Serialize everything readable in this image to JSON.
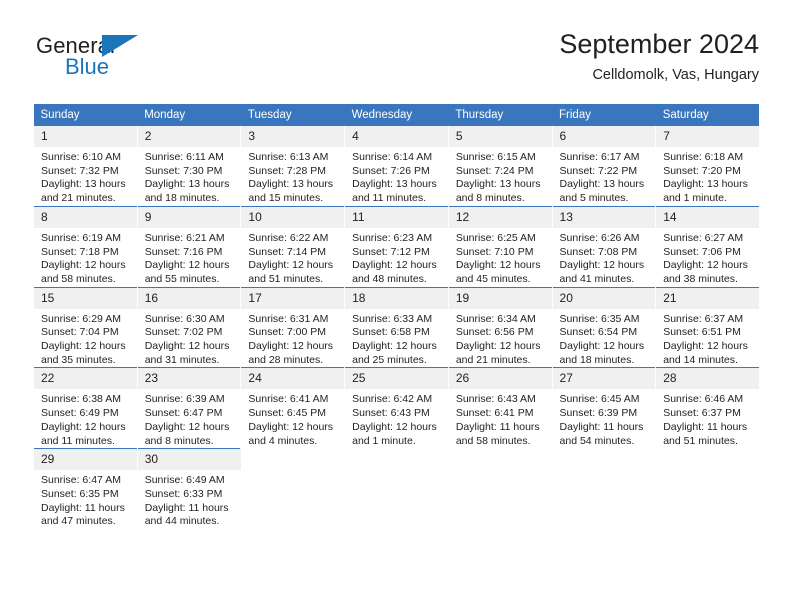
{
  "brand": {
    "name_part1": "General",
    "name_part2": "Blue",
    "flag_icon": "triangle-flag-icon"
  },
  "header": {
    "title": "September 2024",
    "location": "Celldomolk, Vas, Hungary"
  },
  "colors": {
    "header_blue": "#3a76bd",
    "brand_blue": "#1b75bb",
    "daynum_band": "#f0f0f0",
    "text": "#231f20"
  },
  "weekday_headers": [
    "Sunday",
    "Monday",
    "Tuesday",
    "Wednesday",
    "Thursday",
    "Friday",
    "Saturday"
  ],
  "weeks": [
    [
      {
        "day": "1",
        "sunrise": "Sunrise: 6:10 AM",
        "sunset": "Sunset: 7:32 PM",
        "daylight_line1": "Daylight: 13 hours",
        "daylight_line2": "and 21 minutes."
      },
      {
        "day": "2",
        "sunrise": "Sunrise: 6:11 AM",
        "sunset": "Sunset: 7:30 PM",
        "daylight_line1": "Daylight: 13 hours",
        "daylight_line2": "and 18 minutes."
      },
      {
        "day": "3",
        "sunrise": "Sunrise: 6:13 AM",
        "sunset": "Sunset: 7:28 PM",
        "daylight_line1": "Daylight: 13 hours",
        "daylight_line2": "and 15 minutes."
      },
      {
        "day": "4",
        "sunrise": "Sunrise: 6:14 AM",
        "sunset": "Sunset: 7:26 PM",
        "daylight_line1": "Daylight: 13 hours",
        "daylight_line2": "and 11 minutes."
      },
      {
        "day": "5",
        "sunrise": "Sunrise: 6:15 AM",
        "sunset": "Sunset: 7:24 PM",
        "daylight_line1": "Daylight: 13 hours",
        "daylight_line2": "and 8 minutes."
      },
      {
        "day": "6",
        "sunrise": "Sunrise: 6:17 AM",
        "sunset": "Sunset: 7:22 PM",
        "daylight_line1": "Daylight: 13 hours",
        "daylight_line2": "and 5 minutes."
      },
      {
        "day": "7",
        "sunrise": "Sunrise: 6:18 AM",
        "sunset": "Sunset: 7:20 PM",
        "daylight_line1": "Daylight: 13 hours",
        "daylight_line2": "and 1 minute."
      }
    ],
    [
      {
        "day": "8",
        "sunrise": "Sunrise: 6:19 AM",
        "sunset": "Sunset: 7:18 PM",
        "daylight_line1": "Daylight: 12 hours",
        "daylight_line2": "and 58 minutes."
      },
      {
        "day": "9",
        "sunrise": "Sunrise: 6:21 AM",
        "sunset": "Sunset: 7:16 PM",
        "daylight_line1": "Daylight: 12 hours",
        "daylight_line2": "and 55 minutes."
      },
      {
        "day": "10",
        "sunrise": "Sunrise: 6:22 AM",
        "sunset": "Sunset: 7:14 PM",
        "daylight_line1": "Daylight: 12 hours",
        "daylight_line2": "and 51 minutes."
      },
      {
        "day": "11",
        "sunrise": "Sunrise: 6:23 AM",
        "sunset": "Sunset: 7:12 PM",
        "daylight_line1": "Daylight: 12 hours",
        "daylight_line2": "and 48 minutes."
      },
      {
        "day": "12",
        "sunrise": "Sunrise: 6:25 AM",
        "sunset": "Sunset: 7:10 PM",
        "daylight_line1": "Daylight: 12 hours",
        "daylight_line2": "and 45 minutes."
      },
      {
        "day": "13",
        "sunrise": "Sunrise: 6:26 AM",
        "sunset": "Sunset: 7:08 PM",
        "daylight_line1": "Daylight: 12 hours",
        "daylight_line2": "and 41 minutes."
      },
      {
        "day": "14",
        "sunrise": "Sunrise: 6:27 AM",
        "sunset": "Sunset: 7:06 PM",
        "daylight_line1": "Daylight: 12 hours",
        "daylight_line2": "and 38 minutes."
      }
    ],
    [
      {
        "day": "15",
        "sunrise": "Sunrise: 6:29 AM",
        "sunset": "Sunset: 7:04 PM",
        "daylight_line1": "Daylight: 12 hours",
        "daylight_line2": "and 35 minutes."
      },
      {
        "day": "16",
        "sunrise": "Sunrise: 6:30 AM",
        "sunset": "Sunset: 7:02 PM",
        "daylight_line1": "Daylight: 12 hours",
        "daylight_line2": "and 31 minutes."
      },
      {
        "day": "17",
        "sunrise": "Sunrise: 6:31 AM",
        "sunset": "Sunset: 7:00 PM",
        "daylight_line1": "Daylight: 12 hours",
        "daylight_line2": "and 28 minutes."
      },
      {
        "day": "18",
        "sunrise": "Sunrise: 6:33 AM",
        "sunset": "Sunset: 6:58 PM",
        "daylight_line1": "Daylight: 12 hours",
        "daylight_line2": "and 25 minutes."
      },
      {
        "day": "19",
        "sunrise": "Sunrise: 6:34 AM",
        "sunset": "Sunset: 6:56 PM",
        "daylight_line1": "Daylight: 12 hours",
        "daylight_line2": "and 21 minutes."
      },
      {
        "day": "20",
        "sunrise": "Sunrise: 6:35 AM",
        "sunset": "Sunset: 6:54 PM",
        "daylight_line1": "Daylight: 12 hours",
        "daylight_line2": "and 18 minutes."
      },
      {
        "day": "21",
        "sunrise": "Sunrise: 6:37 AM",
        "sunset": "Sunset: 6:51 PM",
        "daylight_line1": "Daylight: 12 hours",
        "daylight_line2": "and 14 minutes."
      }
    ],
    [
      {
        "day": "22",
        "sunrise": "Sunrise: 6:38 AM",
        "sunset": "Sunset: 6:49 PM",
        "daylight_line1": "Daylight: 12 hours",
        "daylight_line2": "and 11 minutes."
      },
      {
        "day": "23",
        "sunrise": "Sunrise: 6:39 AM",
        "sunset": "Sunset: 6:47 PM",
        "daylight_line1": "Daylight: 12 hours",
        "daylight_line2": "and 8 minutes."
      },
      {
        "day": "24",
        "sunrise": "Sunrise: 6:41 AM",
        "sunset": "Sunset: 6:45 PM",
        "daylight_line1": "Daylight: 12 hours",
        "daylight_line2": "and 4 minutes."
      },
      {
        "day": "25",
        "sunrise": "Sunrise: 6:42 AM",
        "sunset": "Sunset: 6:43 PM",
        "daylight_line1": "Daylight: 12 hours",
        "daylight_line2": "and 1 minute."
      },
      {
        "day": "26",
        "sunrise": "Sunrise: 6:43 AM",
        "sunset": "Sunset: 6:41 PM",
        "daylight_line1": "Daylight: 11 hours",
        "daylight_line2": "and 58 minutes."
      },
      {
        "day": "27",
        "sunrise": "Sunrise: 6:45 AM",
        "sunset": "Sunset: 6:39 PM",
        "daylight_line1": "Daylight: 11 hours",
        "daylight_line2": "and 54 minutes."
      },
      {
        "day": "28",
        "sunrise": "Sunrise: 6:46 AM",
        "sunset": "Sunset: 6:37 PM",
        "daylight_line1": "Daylight: 11 hours",
        "daylight_line2": "and 51 minutes."
      }
    ],
    [
      {
        "day": "29",
        "sunrise": "Sunrise: 6:47 AM",
        "sunset": "Sunset: 6:35 PM",
        "daylight_line1": "Daylight: 11 hours",
        "daylight_line2": "and 47 minutes."
      },
      {
        "day": "30",
        "sunrise": "Sunrise: 6:49 AM",
        "sunset": "Sunset: 6:33 PM",
        "daylight_line1": "Daylight: 11 hours",
        "daylight_line2": "and 44 minutes."
      },
      null,
      null,
      null,
      null,
      null
    ]
  ]
}
